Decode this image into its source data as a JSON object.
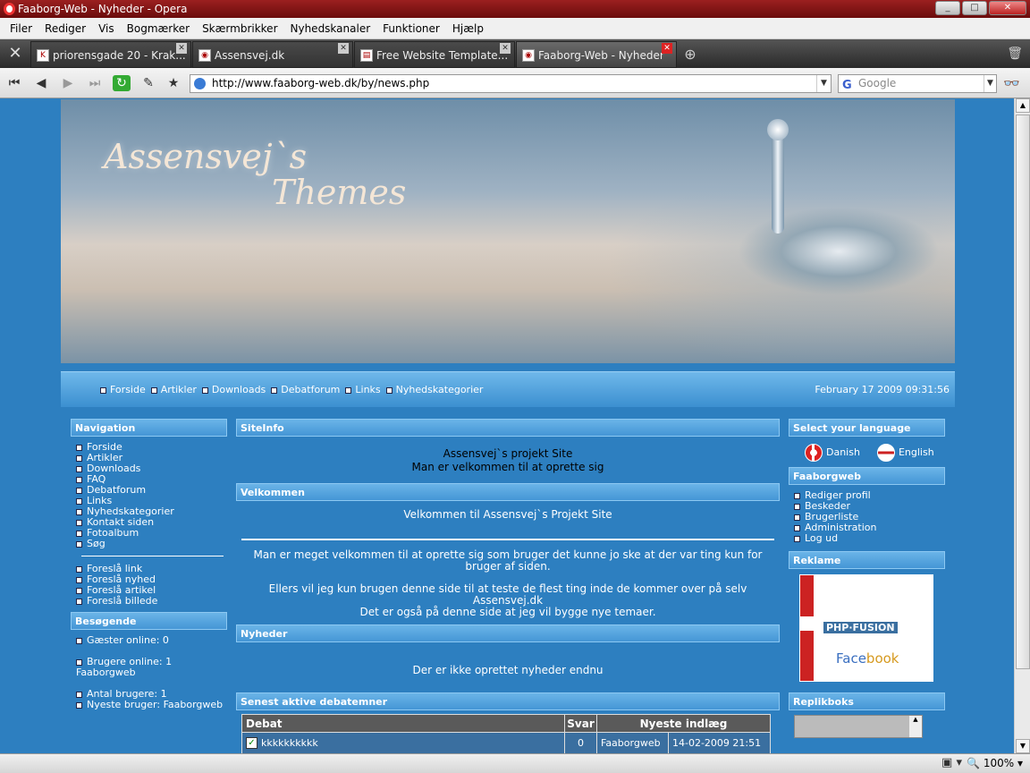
{
  "window": {
    "title": "Faaborg-Web - Nyheder - Opera"
  },
  "menu": [
    "Filer",
    "Rediger",
    "Vis",
    "Bogmærker",
    "Skærmbrikker",
    "Nyhedskanaler",
    "Funktioner",
    "Hjælp"
  ],
  "tabs": [
    {
      "label": "priorensgade 20 - Krak...",
      "active": false
    },
    {
      "label": "Assensvej.dk",
      "active": false
    },
    {
      "label": "Free Website Template...",
      "active": false
    },
    {
      "label": "Faaborg-Web - Nyheder",
      "active": true
    }
  ],
  "address": {
    "url": "http://www.faaborg-web.dk/by/news.php",
    "search_placeholder": "Google"
  },
  "banner": {
    "line1": "Assensvej`s",
    "line2": "Themes"
  },
  "topnav": {
    "links": [
      "Forside",
      "Artikler",
      "Downloads",
      "Debatforum",
      "Links",
      "Nyhedskategorier"
    ],
    "date": "February 17 2009 09:31:56"
  },
  "navigation": {
    "title": "Navigation",
    "items": [
      "Forside",
      "Artikler",
      "Downloads",
      "FAQ",
      "Debatforum",
      "Links",
      "Nyhedskategorier",
      "Kontakt siden",
      "Fotoalbum",
      "Søg"
    ],
    "suggest": [
      "Foreslå link",
      "Foreslå nyhed",
      "Foreslå artikel",
      "Foreslå billede"
    ]
  },
  "visitors": {
    "title": "Besøgende",
    "guests": "Gæster online: 0",
    "users": "Brugere online: 1",
    "users_name": "Faaborgweb",
    "count": "Antal brugere: 1",
    "newest": "Nyeste bruger: Faaborgweb"
  },
  "siteinfo": {
    "title": "SiteInfo",
    "line1": "Assensvej`s projekt Site",
    "line2": "Man er velkommen til at oprette sig"
  },
  "welcome": {
    "title": "Velkommen",
    "heading": "Velkommen til Assensvej`s Projekt Site",
    "p1": "Man er meget velkommen til at oprette sig som bruger det kunne jo ske at der var ting kun for bruger af siden.",
    "p2a": "Ellers vil jeg kun brugen denne side til at teste de flest ting inde de kommer over på selv Assensvej.dk",
    "p2b": "Det er også på denne side at jeg vil bygge nye temaer."
  },
  "news": {
    "title": "Nyheder",
    "empty": "Der er ikke oprettet nyheder endnu"
  },
  "forum": {
    "title": "Senest aktive debatemner",
    "headers": [
      "Debat",
      "Svar",
      "Nyeste indlæg"
    ],
    "rows": [
      {
        "topic": "kkkkkkkkkk",
        "replies": "0",
        "user": "Faaborgweb",
        "date": "14-02-2009 21:51"
      }
    ]
  },
  "language": {
    "title": "Select your language",
    "danish": "Danish",
    "english": "English"
  },
  "userpanel": {
    "title": "Faaborgweb",
    "items": [
      "Rediger profil",
      "Beskeder",
      "Brugerliste",
      "Administration",
      "Log ud"
    ]
  },
  "ads": {
    "title": "Reklame",
    "php": "PHP·FUSION",
    "fb1": "Face",
    "fb2": "book"
  },
  "shoutbox": {
    "title": "Replikboks"
  },
  "status": {
    "zoom": "100%"
  }
}
